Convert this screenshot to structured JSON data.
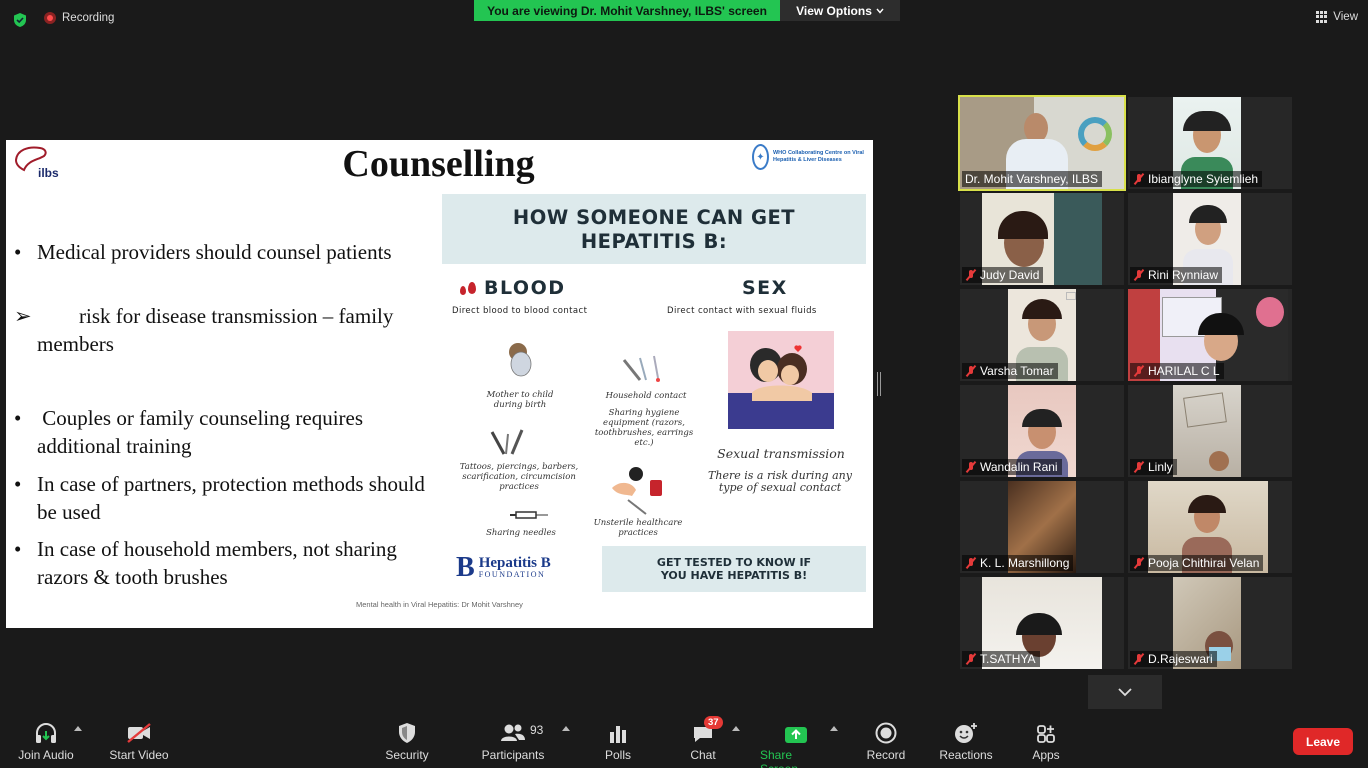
{
  "top": {
    "recording_label": "Recording",
    "viewing_banner": "You are viewing Dr. Mohit Varshney, ILBS' screen",
    "view_options_label": "View Options",
    "view_label": "View"
  },
  "slide": {
    "logo_text": "ilbs",
    "title": "Counselling",
    "who_text": "WHO Collaborating Centre on Viral Hepatitis & Liver Diseases",
    "bullets": [
      {
        "mark": "•",
        "text": "Medical providers should counsel patients"
      },
      {
        "mark": "➢",
        "text": "        risk for disease transmission – family members"
      },
      {
        "mark": "•",
        "text": " Couples or family counseling requires additional training"
      },
      {
        "mark": "•",
        "text": "In case of partners, protection methods should be used"
      },
      {
        "mark": "•",
        "text": "In case of household members, not sharing razors & tooth brushes"
      }
    ],
    "infographic": {
      "heading_line1": "HOW SOMEONE CAN GET",
      "heading_line2": "HEPATITIS B:",
      "blood_title": "BLOOD",
      "blood_sub": "Direct blood to blood contact",
      "sex_title": "SEX",
      "sex_sub": "Direct contact with sexual fluids",
      "mother_child": "Mother to child during birth",
      "household": "Household contact",
      "sharing_hygiene": "Sharing hygiene equipment (razors, toothbrushes, earrings etc.)",
      "tattoos": "Tattoos, piercings, barbers, scarification, circumcision practices",
      "needles": "Sharing needles",
      "unsterile": "Unsterile healthcare practices",
      "sexual_transmission": "Sexual transmission",
      "risk_text": "There is a risk during any type of sexual contact",
      "hepb_name": "Hepatitis B",
      "hepb_foundation": "FOUNDATION",
      "footer_line1": "GET TESTED TO KNOW IF",
      "footer_line2": "YOU HAVE HEPATITIS B!"
    },
    "footer": "Mental health in Viral Hepatitis: Dr Mohit Varshney"
  },
  "participants": [
    {
      "name": "Dr. Mohit Varshney, ILBS",
      "muted": false,
      "active": true
    },
    {
      "name": "Ibianglyne Syiemlieh",
      "muted": true
    },
    {
      "name": "Judy David",
      "muted": true
    },
    {
      "name": "Rini Rynniaw",
      "muted": true
    },
    {
      "name": "Varsha Tomar",
      "muted": true
    },
    {
      "name": "HARILAL C L",
      "muted": true
    },
    {
      "name": "Wandalin Rani",
      "muted": true
    },
    {
      "name": "Linly",
      "muted": true
    },
    {
      "name": "K. L. Marshillong",
      "muted": true
    },
    {
      "name": "Pooja Chithirai Velan",
      "muted": true
    },
    {
      "name": "T.SATHYA",
      "muted": true
    },
    {
      "name": "D.Rajeswari",
      "muted": true
    }
  ],
  "toolbar": {
    "join_audio": "Join Audio",
    "start_video": "Start Video",
    "security": "Security",
    "participants": "Participants",
    "participants_count": "93",
    "polls": "Polls",
    "chat": "Chat",
    "chat_badge": "37",
    "share_screen": "Share Screen",
    "record": "Record",
    "reactions": "Reactions",
    "apps": "Apps",
    "leave": "Leave"
  },
  "colors": {
    "banner_green": "#23c552",
    "leave_red": "#e02828",
    "active_speaker_outline": "#d8e04a",
    "share_green": "#23c552"
  }
}
